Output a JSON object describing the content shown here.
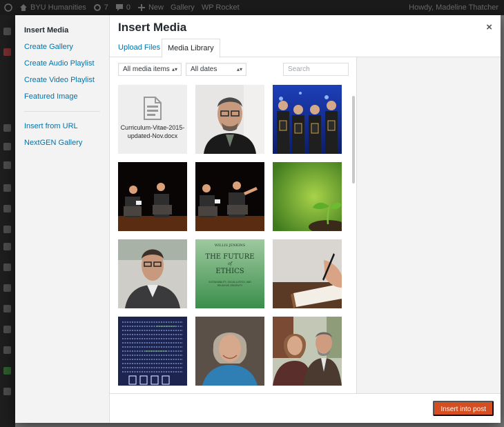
{
  "admin_bar": {
    "site_name": "BYU Humanities",
    "updates_count": "7",
    "comments_count": "0",
    "new_label": "New",
    "gallery_label": "Gallery",
    "wp_rocket_label": "WP Rocket",
    "greeting": "Howdy, Madeline Thatcher"
  },
  "modal": {
    "title": "Insert Media",
    "close_icon": "×"
  },
  "media_menu": {
    "items": [
      {
        "label": "Insert Media",
        "active": true
      },
      {
        "label": "Create Gallery"
      },
      {
        "label": "Create Audio Playlist"
      },
      {
        "label": "Create Video Playlist"
      },
      {
        "label": "Featured Image"
      },
      {
        "label": "Insert from URL"
      },
      {
        "label": "NextGEN Gallery"
      }
    ]
  },
  "router": {
    "tabs": [
      {
        "label": "Upload Files"
      },
      {
        "label": "Media Library",
        "active": true
      }
    ]
  },
  "toolbar": {
    "media_filter": "All media items",
    "date_filter": "All dates",
    "search_placeholder": "Search"
  },
  "attachments": [
    {
      "kind": "document",
      "filename": "Curriculum-Vitae-2015-updated-Nov.docx",
      "icon": "document-icon"
    },
    {
      "kind": "image",
      "name": "man-portrait-glasses"
    },
    {
      "kind": "image",
      "name": "award-group-photo"
    },
    {
      "kind": "image",
      "name": "stage-interview-1"
    },
    {
      "kind": "image",
      "name": "stage-interview-2"
    },
    {
      "kind": "image",
      "name": "seedling-sprout"
    },
    {
      "kind": "image",
      "name": "man-portrait-outdoor"
    },
    {
      "kind": "image",
      "name": "book-cover-future-of-ethics",
      "cover_text": {
        "author": "WILLIS JENKINS",
        "line1": "THE FUTURE",
        "line2": "of",
        "line3": "ETHICS",
        "sub1": "SUSTAINABILITY, SOCIAL JUSTICE, AND",
        "sub2": "RELIGIOUS CREATIVITY"
      }
    },
    {
      "kind": "image",
      "name": "hand-writing-notebook"
    },
    {
      "kind": "image",
      "name": "manuscript-page"
    },
    {
      "kind": "image",
      "name": "woman-portrait"
    },
    {
      "kind": "image",
      "name": "couple-portrait"
    }
  ],
  "footer": {
    "insert_button": "Insert into post"
  },
  "colors": {
    "accent_link": "#0073aa",
    "insert_button": "#d54e21",
    "admin_bar": "#1b1b1b"
  }
}
